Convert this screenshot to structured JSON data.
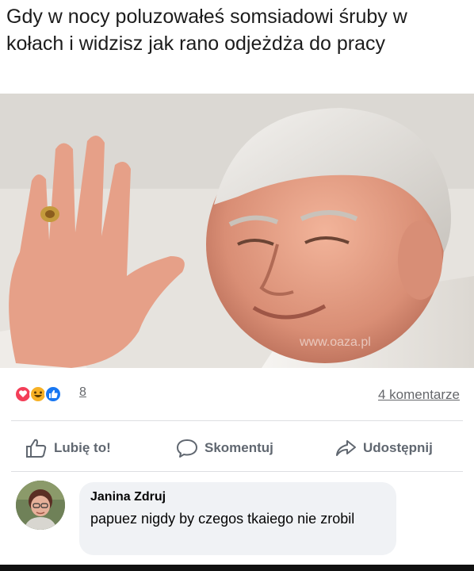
{
  "meme": {
    "caption": "Gdy w nocy poluzowałeś somsiadowi śruby w kołach i widzisz jak rano odjeżdża do pracy",
    "watermark": "www.oaza.pl"
  },
  "post_footer": {
    "reaction_count": "8",
    "comments_label": "4 komentarze",
    "reaction_icons": [
      "love-reaction",
      "haha-reaction",
      "like-reaction"
    ]
  },
  "actions": {
    "like_label": "Lubię to!",
    "comment_label": "Skomentuj",
    "share_label": "Udostępnij"
  },
  "comment": {
    "author": "Janina Zdruj",
    "text": "papuez nigdy by czegos tkaiego nie zrobil"
  },
  "colors": {
    "like_blue": "#1877f2",
    "love_red": "#f33e58",
    "haha_yellow": "#f7b125",
    "muted_text": "#65676b"
  }
}
